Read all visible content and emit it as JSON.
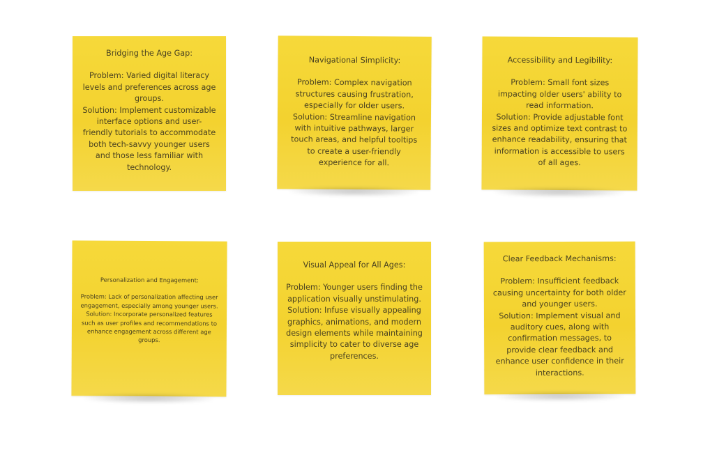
{
  "notes": [
    {
      "title": "Bridging the Age Gap:",
      "problem": "Problem: Varied digital literacy levels and preferences across age groups.",
      "solution": "Solution: Implement customizable interface options and user-friendly tutorials to accommodate both tech-savvy younger users and those less familiar with technology."
    },
    {
      "title": "Navigational Simplicity:",
      "problem": "Problem: Complex navigation structures causing frustration, especially for older users.",
      "solution": "Solution: Streamline navigation with intuitive pathways, larger touch areas, and helpful tooltips to create a user-friendly experience for all."
    },
    {
      "title": "Accessibility and Legibility:",
      "problem": "Problem: Small font sizes impacting older users' ability to read information.",
      "solution": "Solution: Provide adjustable font sizes and optimize text contrast to enhance readability, ensuring that information is accessible to users of all ages."
    },
    {
      "title": "Personalization and Engagement:",
      "problem": "Problem: Lack of personalization affecting user engagement, especially among younger users.",
      "solution": "Solution: Incorporate personalized features such as user profiles and recommendations to enhance engagement across different age groups."
    },
    {
      "title": "Visual Appeal for All Ages:",
      "problem": "Problem: Younger users finding the application visually unstimulating.",
      "solution": "Solution: Infuse visually appealing graphics, animations, and modern design elements while maintaining simplicity to cater to diverse age preferences."
    },
    {
      "title": "Clear Feedback Mechanisms:",
      "problem": "Problem: Insufficient feedback causing uncertainty for both older and younger users.",
      "solution": "Solution: Implement visual and auditory cues, along with confirmation messages, to provide clear feedback and enhance user confidence in their interactions."
    }
  ],
  "colors": {
    "note_fill": "#f3d22f",
    "note_text": "#4a4220",
    "background": "#ffffff"
  }
}
